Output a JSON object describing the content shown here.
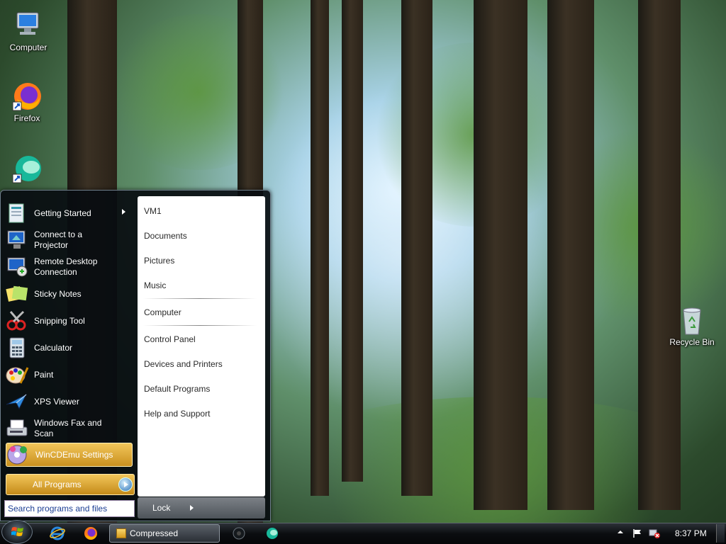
{
  "desktop": {
    "icons": [
      {
        "label": "Computer",
        "icon": "computer-icon"
      },
      {
        "label": "Firefox",
        "icon": "firefox-icon"
      },
      {
        "label": "",
        "icon": "app-shortcut-icon"
      },
      {
        "label": "Recycle Bin",
        "icon": "recycle-bin-icon"
      }
    ]
  },
  "start_menu": {
    "programs": [
      {
        "label": "Getting Started",
        "icon": "getting-started-icon",
        "has_submenu": true
      },
      {
        "label": "Connect to a Projector",
        "icon": "projector-icon"
      },
      {
        "label": "Remote Desktop Connection",
        "icon": "remote-desktop-icon"
      },
      {
        "label": "Sticky Notes",
        "icon": "sticky-notes-icon"
      },
      {
        "label": "Snipping Tool",
        "icon": "snipping-tool-icon"
      },
      {
        "label": "Calculator",
        "icon": "calculator-icon"
      },
      {
        "label": "Paint",
        "icon": "paint-icon"
      },
      {
        "label": "XPS Viewer",
        "icon": "xps-viewer-icon"
      },
      {
        "label": "Windows Fax and Scan",
        "icon": "fax-scan-icon"
      },
      {
        "label": "WinCDEmu Settings",
        "icon": "wincdemu-icon",
        "highlighted": true
      }
    ],
    "all_programs_label": "All Programs",
    "search_placeholder": "Search programs and files",
    "places": [
      "VM1",
      "Documents",
      "Pictures",
      "Music",
      "Computer",
      "Control Panel",
      "Devices and Printers",
      "Default Programs",
      "Help and Support"
    ],
    "lock_label": "Lock"
  },
  "taskbar": {
    "pinned": [
      "internet-explorer-icon",
      "firefox-icon"
    ],
    "running_window": "Compressed",
    "extra_icons": [
      "media-player-icon",
      "app-icon"
    ],
    "clock": "8:37 PM",
    "tray_icons": [
      "show-hidden-icons-icon",
      "action-center-flag-icon",
      "network-disconnected-icon"
    ]
  }
}
